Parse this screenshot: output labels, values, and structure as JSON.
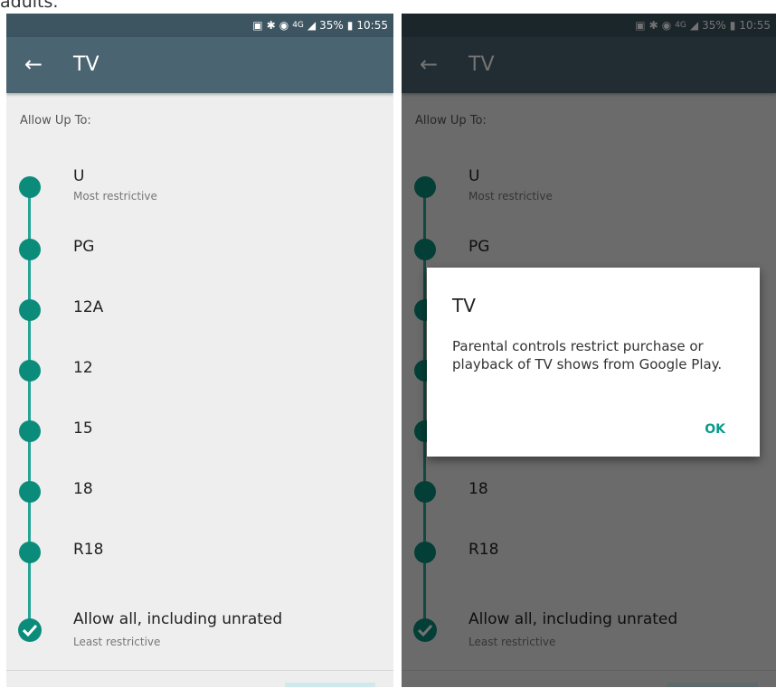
{
  "caption_fragment": "adults.",
  "status": {
    "time": "10:55",
    "battery": "35%",
    "signal": "4G"
  },
  "appbar": {
    "title": "TV"
  },
  "section_label": "Allow Up To:",
  "ratings": [
    {
      "label": "U",
      "sub": "Most restrictive"
    },
    {
      "label": "PG",
      "sub": ""
    },
    {
      "label": "12A",
      "sub": ""
    },
    {
      "label": "12",
      "sub": ""
    },
    {
      "label": "15",
      "sub": ""
    },
    {
      "label": "18",
      "sub": ""
    },
    {
      "label": "R18",
      "sub": ""
    },
    {
      "label": "Allow all, including unrated",
      "sub": "Least restrictive",
      "selected": true
    }
  ],
  "dialog": {
    "title": "TV",
    "body": "Parental controls restrict purchase or playback of TV shows from Google Play.",
    "ok": "OK"
  },
  "colors": {
    "appbar": "#4b6472",
    "statusbar": "#3d5461",
    "accent": "#0b8c7b",
    "background": "#eeeeee"
  }
}
